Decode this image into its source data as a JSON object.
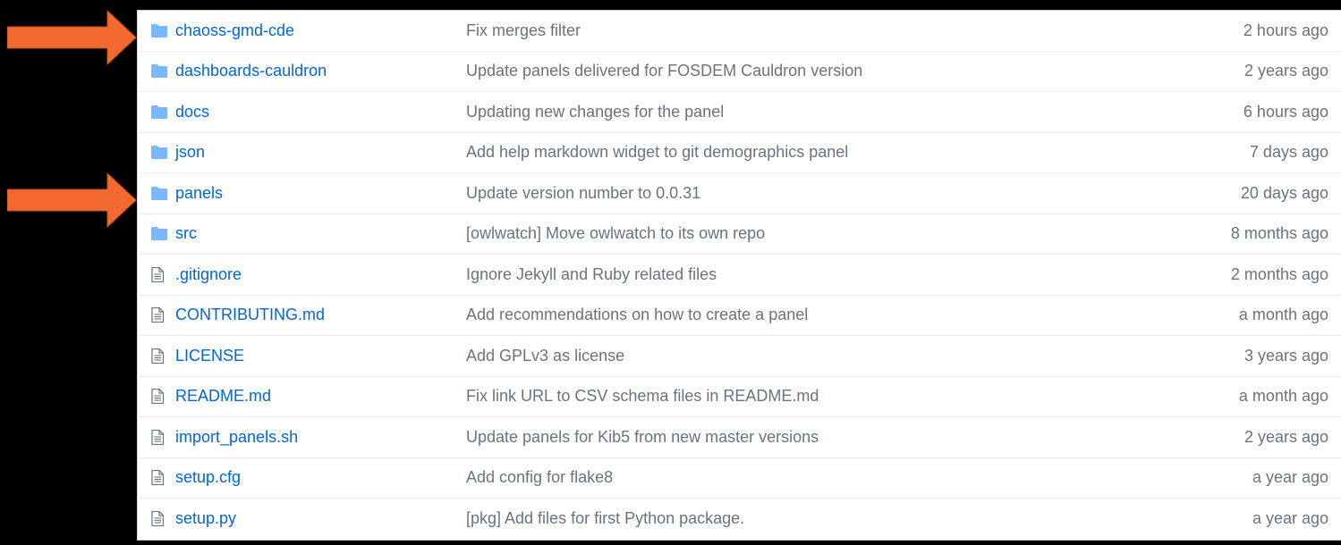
{
  "colors": {
    "link": "#0366d6",
    "muted": "#6a737d",
    "folder_icon": "#79b8ff",
    "file_icon": "#6a737d",
    "arrow": "#f26a2e",
    "background": "#000000"
  },
  "annotations": {
    "arrows": [
      {
        "points_to": "chaoss-gmd-cde"
      },
      {
        "points_to": "panels"
      }
    ]
  },
  "files": [
    {
      "type": "folder",
      "icon": "folder-icon",
      "name": "chaoss-gmd-cde",
      "message": "Fix merges filter",
      "age": "2 hours ago"
    },
    {
      "type": "folder",
      "icon": "folder-icon",
      "name": "dashboards-cauldron",
      "message": "Update panels delivered for FOSDEM Cauldron version",
      "age": "2 years ago"
    },
    {
      "type": "folder",
      "icon": "folder-icon",
      "name": "docs",
      "message": "Updating new changes for the panel",
      "age": "6 hours ago"
    },
    {
      "type": "folder",
      "icon": "folder-icon",
      "name": "json",
      "message": "Add help markdown widget to git demographics panel",
      "age": "7 days ago"
    },
    {
      "type": "folder",
      "icon": "folder-icon",
      "name": "panels",
      "message": "Update version number to 0.0.31",
      "age": "20 days ago"
    },
    {
      "type": "folder",
      "icon": "folder-icon",
      "name": "src",
      "message": "[owlwatch] Move owlwatch to its own repo",
      "age": "8 months ago"
    },
    {
      "type": "file",
      "icon": "file-icon",
      "name": ".gitignore",
      "message": "Ignore Jekyll and Ruby related files",
      "age": "2 months ago"
    },
    {
      "type": "file",
      "icon": "file-icon",
      "name": "CONTRIBUTING.md",
      "message": "Add recommendations on how to create a panel",
      "age": "a month ago"
    },
    {
      "type": "file",
      "icon": "file-icon",
      "name": "LICENSE",
      "message": "Add GPLv3 as license",
      "age": "3 years ago"
    },
    {
      "type": "file",
      "icon": "file-icon",
      "name": "README.md",
      "message": "Fix link URL to CSV schema files in README.md",
      "age": "a month ago"
    },
    {
      "type": "file",
      "icon": "file-icon",
      "name": "import_panels.sh",
      "message": "Update panels for Kib5 from new master versions",
      "age": "2 years ago"
    },
    {
      "type": "file",
      "icon": "file-icon",
      "name": "setup.cfg",
      "message": "Add config for flake8",
      "age": "a year ago"
    },
    {
      "type": "file",
      "icon": "file-icon",
      "name": "setup.py",
      "message": "[pkg] Add files for first Python package.",
      "age": "a year ago"
    }
  ]
}
